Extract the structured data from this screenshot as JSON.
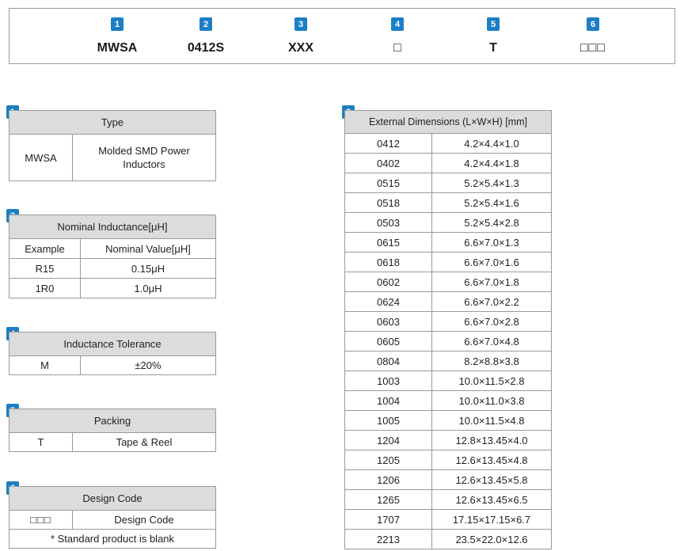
{
  "part_number": {
    "segments": [
      {
        "num": "1",
        "code": "MWSA"
      },
      {
        "num": "2",
        "code": "0412S"
      },
      {
        "num": "3",
        "code": "XXX"
      },
      {
        "num": "4",
        "code": "□"
      },
      {
        "num": "5",
        "code": "T"
      },
      {
        "num": "6",
        "code": "□□□"
      }
    ]
  },
  "type_table": {
    "num": "1",
    "header": "Type",
    "code": "MWSA",
    "description": "Molded SMD Power Inductors"
  },
  "inductance_table": {
    "num": "3",
    "header": "Nominal Inductance[μH]",
    "col_headers": [
      "Example",
      "Nominal Value[μH]"
    ],
    "rows": [
      [
        "R15",
        "0.15μH"
      ],
      [
        "1R0",
        "1.0μH"
      ]
    ]
  },
  "tolerance_table": {
    "num": "4",
    "header": "Inductance Tolerance",
    "code": "M",
    "value": "±20%"
  },
  "packing_table": {
    "num": "5",
    "header": "Packing",
    "code": "T",
    "value": "Tape & Reel"
  },
  "design_table": {
    "num": "6",
    "header": "Design Code",
    "code_glyphs": "□□□",
    "value": "Design Code",
    "note": "* Standard product is blank"
  },
  "dimensions_table": {
    "num": "2",
    "header": "External Dimensions (L×W×H) [mm]",
    "rows": [
      [
        "0412",
        "4.2×4.4×1.0"
      ],
      [
        "0402",
        "4.2×4.4×1.8"
      ],
      [
        "0515",
        "5.2×5.4×1.3"
      ],
      [
        "0518",
        "5.2×5.4×1.6"
      ],
      [
        "0503",
        "5.2×5.4×2.8"
      ],
      [
        "0615",
        "6.6×7.0×1.3"
      ],
      [
        "0618",
        "6.6×7.0×1.6"
      ],
      [
        "0602",
        "6.6×7.0×1.8"
      ],
      [
        "0624",
        "6.6×7.0×2.2"
      ],
      [
        "0603",
        "6.6×7.0×2.8"
      ],
      [
        "0605",
        "6.6×7.0×4.8"
      ],
      [
        "0804",
        "8.2×8.8×3.8"
      ],
      [
        "1003",
        "10.0×11.5×2.8"
      ],
      [
        "1004",
        "10.0×11.0×3.8"
      ],
      [
        "1005",
        "10.0×11.5×4.8"
      ],
      [
        "1204",
        "12.8×13.45×4.0"
      ],
      [
        "1205",
        "12.6×13.45×4.8"
      ],
      [
        "1206",
        "12.6×13.45×5.8"
      ],
      [
        "1265",
        "12.6×13.45×6.5"
      ],
      [
        "1707",
        "17.15×17.15×6.7"
      ],
      [
        "2213",
        "23.5×22.0×12.6"
      ]
    ]
  }
}
